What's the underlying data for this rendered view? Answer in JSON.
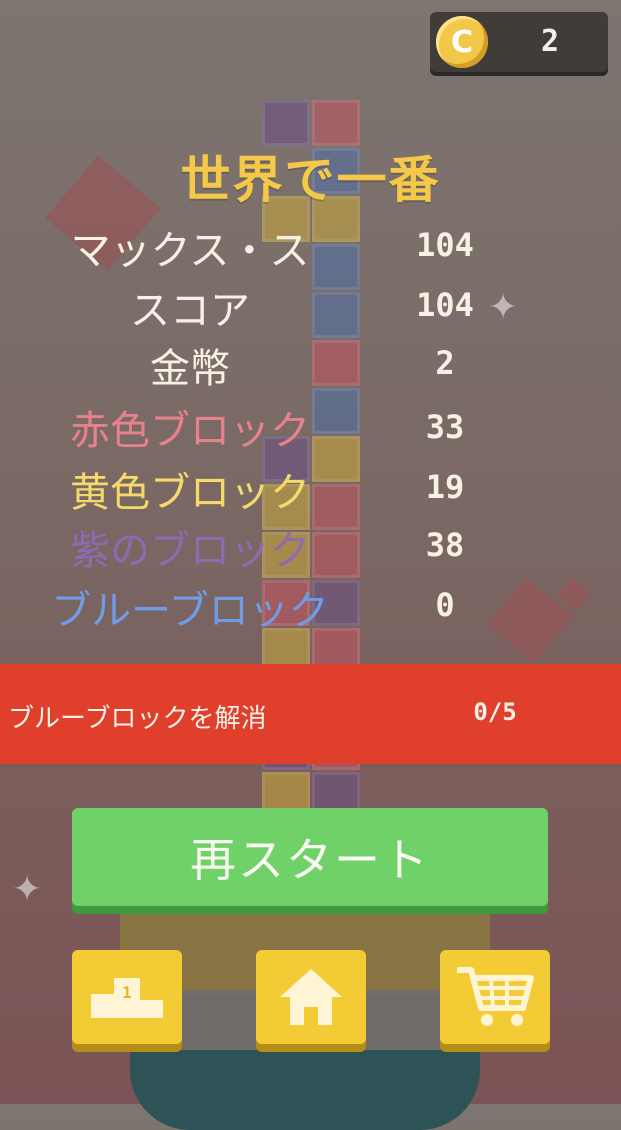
{
  "hud": {
    "coin_icon_letter": "C",
    "coin_count": "2"
  },
  "results": {
    "headline": "世界で一番",
    "stats": [
      {
        "label": "マックス・ス",
        "value": "104"
      },
      {
        "label": "スコア",
        "value": "104"
      },
      {
        "label": "金幣",
        "value": "2"
      },
      {
        "label": "赤色ブロック",
        "value": "33"
      },
      {
        "label": "黄色ブロック",
        "value": "19"
      },
      {
        "label": "紫のブロック",
        "value": "38"
      },
      {
        "label": "ブルーブロック",
        "value": "0"
      }
    ]
  },
  "mission": {
    "text": "ブルーブロックを解消",
    "progress": "0/5"
  },
  "buttons": {
    "restart_label": "再スタート",
    "podium_rank": "1",
    "leaderboard_icon": "podium-icon",
    "home_icon": "home-icon",
    "shop_icon": "cart-icon"
  },
  "colors": {
    "headline": "#f4c94a",
    "red_label": "#e7818c",
    "yellow_label": "#f5da6b",
    "purple_label": "#8e6ab0",
    "blue_label": "#6f9ce4",
    "mission_bar": "#e03f2c",
    "restart_button": "#6fd167",
    "icon_button": "#f3cb35"
  }
}
